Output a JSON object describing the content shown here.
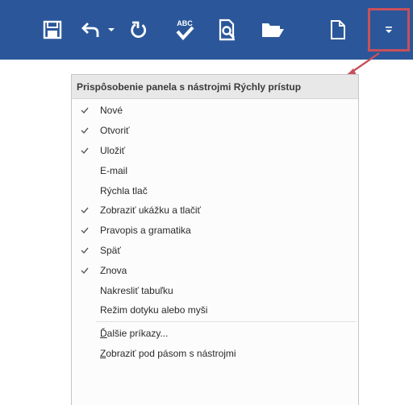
{
  "toolbar": {
    "background_color": "#2b579a",
    "highlight_color": "#c8505a",
    "buttons": [
      {
        "name": "save-icon"
      },
      {
        "name": "undo-icon"
      },
      {
        "name": "undo-dropdown-icon"
      },
      {
        "name": "redo-icon"
      },
      {
        "name": "spelling-abc-icon"
      },
      {
        "name": "print-preview-icon"
      },
      {
        "name": "open-folder-icon"
      },
      {
        "name": "new-document-icon"
      },
      {
        "name": "customize-dropdown-icon"
      }
    ],
    "spelling_icon_text": "ABC"
  },
  "menu": {
    "title": "Prispôsobenie panela s nástrojmi Rýchly prístup",
    "items": [
      {
        "label": "Nové",
        "checked": true
      },
      {
        "label": "Otvoriť",
        "checked": true
      },
      {
        "label": "Uložiť",
        "checked": true
      },
      {
        "label": "E-mail",
        "checked": false
      },
      {
        "label": "Rýchla tlač",
        "checked": false
      },
      {
        "label": "Zobraziť ukážku a tlačiť",
        "checked": true
      },
      {
        "label": "Pravopis a gramatika",
        "checked": true
      },
      {
        "label": "Späť",
        "checked": true
      },
      {
        "label": "Znova",
        "checked": true
      },
      {
        "label": "Nakresliť tabuľku",
        "checked": false
      },
      {
        "label": "Režim dotyku alebo myši",
        "checked": false
      }
    ],
    "more_commands": {
      "mnemonic": "Ď",
      "rest": "alšie príkazy..."
    },
    "show_below": {
      "mnemonic": "Z",
      "rest": "obraziť pod pásom s nástrojmi"
    }
  }
}
